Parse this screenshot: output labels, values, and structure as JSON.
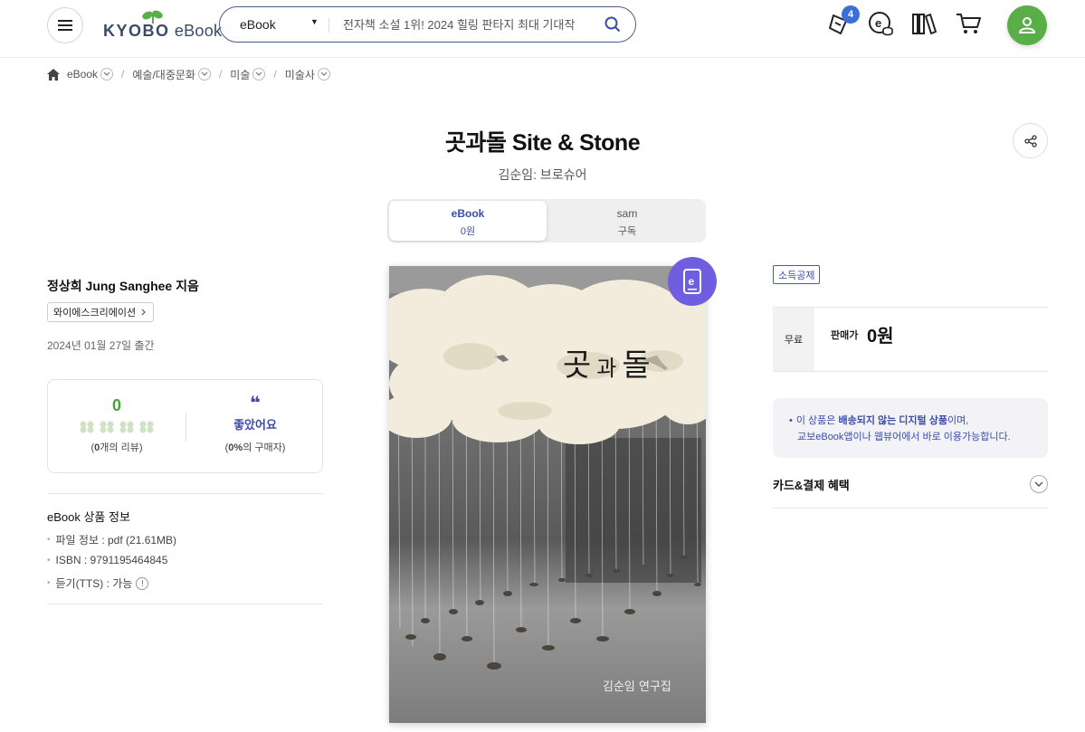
{
  "header": {
    "logo": "KYOBO eBook",
    "search": {
      "category": "eBook",
      "placeholder": "전자책 소설 1위! 2024 힐링 판타지 최대 기대작"
    },
    "notification_count": "4",
    "icons": [
      "menu-icon",
      "search-icon",
      "ticket-icon",
      "ecash-icon",
      "library-icon",
      "cart-icon",
      "user-icon"
    ]
  },
  "breadcrumb": [
    "eBook",
    "예술/대중문화",
    "미술",
    "미술사"
  ],
  "product": {
    "title": "곳과돌 Site & Stone",
    "subtitle": "김순임: 브로슈어",
    "formats": [
      {
        "name": "eBook",
        "price": "0원"
      },
      {
        "name": "sam",
        "price": "구독"
      }
    ],
    "author": "정상희 Jung Sanghee 지음",
    "publisher": "와이에스크리에이션",
    "pub_date": "2024년 01월 27일 출간"
  },
  "review": {
    "count": "0",
    "count_note_num": "0",
    "count_note_text": "개의 리뷰)",
    "like_label": "좋았어요",
    "percent_num": "0%",
    "percent_text": "의 구매자)"
  },
  "ebook_info": {
    "title": "eBook 상품 정보",
    "items": [
      "파일 정보 : pdf (21.61MB)",
      "ISBN : 9791195464845",
      "듣기(TTS) : 가능"
    ]
  },
  "cover": {
    "title_main": "곳",
    "title_mid": "과",
    "title_end": "돌",
    "author": "김순임 연구집"
  },
  "purchase": {
    "tax_badge": "소득공제",
    "price_type": "무료",
    "price_label": "판매가",
    "price": "0원",
    "notice_line1_pre": "이 상품은 ",
    "notice_line1_bold": "배송되지 않는 디지털 상품",
    "notice_line1_post": "이며,",
    "notice_line2": "교보eBook앱이나 웹뷰어에서 바로 이용가능합니다.",
    "benefit_label": "카드&결제 혜택"
  },
  "colors": {
    "accent_navy": "#3b4da8",
    "brand_green": "#5aae48",
    "badge_blue": "#3b6fd8",
    "ebook_badge_purple": "#6f5fe0"
  }
}
